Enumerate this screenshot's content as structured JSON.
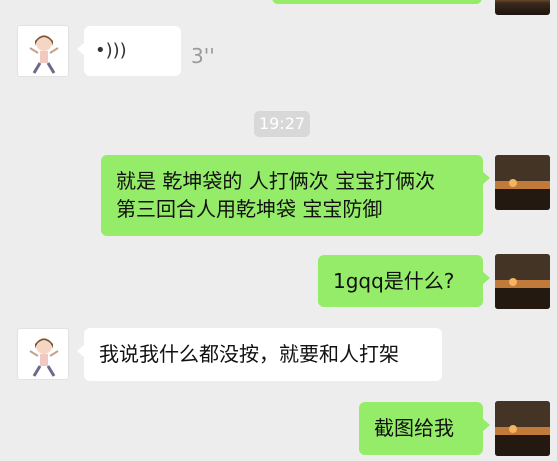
{
  "timestamp": "19:27",
  "messages": [
    {
      "sender": "self",
      "type": "text",
      "text": ""
    },
    {
      "sender": "other",
      "type": "voice",
      "duration": "3''",
      "icon": "voice-wave-icon"
    },
    {
      "sender": "self",
      "type": "text",
      "lines": [
        "就是 乾坤袋的 人打俩次 宝宝打俩次",
        "第三回合人用乾坤袋 宝宝防御"
      ]
    },
    {
      "sender": "self",
      "type": "text",
      "text": "1gqq是什么?"
    },
    {
      "sender": "other",
      "type": "text",
      "text": "我说我什么都没按，就要和人打架"
    },
    {
      "sender": "self",
      "type": "text",
      "text": "截图给我"
    }
  ],
  "colors": {
    "background": "#ededed",
    "self_bubble": "#95ec69",
    "other_bubble": "#ffffff",
    "time_chip": "#d8d8d8"
  }
}
